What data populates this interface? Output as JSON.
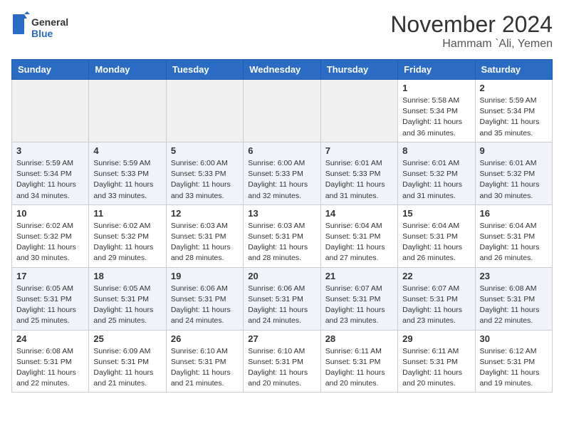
{
  "header": {
    "logo_general": "General",
    "logo_blue": "Blue",
    "month_year": "November 2024",
    "location": "Hammam `Ali, Yemen"
  },
  "weekdays": [
    "Sunday",
    "Monday",
    "Tuesday",
    "Wednesday",
    "Thursday",
    "Friday",
    "Saturday"
  ],
  "weeks": [
    [
      {
        "day": "",
        "info": ""
      },
      {
        "day": "",
        "info": ""
      },
      {
        "day": "",
        "info": ""
      },
      {
        "day": "",
        "info": ""
      },
      {
        "day": "",
        "info": ""
      },
      {
        "day": "1",
        "info": "Sunrise: 5:58 AM\nSunset: 5:34 PM\nDaylight: 11 hours\nand 36 minutes."
      },
      {
        "day": "2",
        "info": "Sunrise: 5:59 AM\nSunset: 5:34 PM\nDaylight: 11 hours\nand 35 minutes."
      }
    ],
    [
      {
        "day": "3",
        "info": "Sunrise: 5:59 AM\nSunset: 5:34 PM\nDaylight: 11 hours\nand 34 minutes."
      },
      {
        "day": "4",
        "info": "Sunrise: 5:59 AM\nSunset: 5:33 PM\nDaylight: 11 hours\nand 33 minutes."
      },
      {
        "day": "5",
        "info": "Sunrise: 6:00 AM\nSunset: 5:33 PM\nDaylight: 11 hours\nand 33 minutes."
      },
      {
        "day": "6",
        "info": "Sunrise: 6:00 AM\nSunset: 5:33 PM\nDaylight: 11 hours\nand 32 minutes."
      },
      {
        "day": "7",
        "info": "Sunrise: 6:01 AM\nSunset: 5:33 PM\nDaylight: 11 hours\nand 31 minutes."
      },
      {
        "day": "8",
        "info": "Sunrise: 6:01 AM\nSunset: 5:32 PM\nDaylight: 11 hours\nand 31 minutes."
      },
      {
        "day": "9",
        "info": "Sunrise: 6:01 AM\nSunset: 5:32 PM\nDaylight: 11 hours\nand 30 minutes."
      }
    ],
    [
      {
        "day": "10",
        "info": "Sunrise: 6:02 AM\nSunset: 5:32 PM\nDaylight: 11 hours\nand 30 minutes."
      },
      {
        "day": "11",
        "info": "Sunrise: 6:02 AM\nSunset: 5:32 PM\nDaylight: 11 hours\nand 29 minutes."
      },
      {
        "day": "12",
        "info": "Sunrise: 6:03 AM\nSunset: 5:31 PM\nDaylight: 11 hours\nand 28 minutes."
      },
      {
        "day": "13",
        "info": "Sunrise: 6:03 AM\nSunset: 5:31 PM\nDaylight: 11 hours\nand 28 minutes."
      },
      {
        "day": "14",
        "info": "Sunrise: 6:04 AM\nSunset: 5:31 PM\nDaylight: 11 hours\nand 27 minutes."
      },
      {
        "day": "15",
        "info": "Sunrise: 6:04 AM\nSunset: 5:31 PM\nDaylight: 11 hours\nand 26 minutes."
      },
      {
        "day": "16",
        "info": "Sunrise: 6:04 AM\nSunset: 5:31 PM\nDaylight: 11 hours\nand 26 minutes."
      }
    ],
    [
      {
        "day": "17",
        "info": "Sunrise: 6:05 AM\nSunset: 5:31 PM\nDaylight: 11 hours\nand 25 minutes."
      },
      {
        "day": "18",
        "info": "Sunrise: 6:05 AM\nSunset: 5:31 PM\nDaylight: 11 hours\nand 25 minutes."
      },
      {
        "day": "19",
        "info": "Sunrise: 6:06 AM\nSunset: 5:31 PM\nDaylight: 11 hours\nand 24 minutes."
      },
      {
        "day": "20",
        "info": "Sunrise: 6:06 AM\nSunset: 5:31 PM\nDaylight: 11 hours\nand 24 minutes."
      },
      {
        "day": "21",
        "info": "Sunrise: 6:07 AM\nSunset: 5:31 PM\nDaylight: 11 hours\nand 23 minutes."
      },
      {
        "day": "22",
        "info": "Sunrise: 6:07 AM\nSunset: 5:31 PM\nDaylight: 11 hours\nand 23 minutes."
      },
      {
        "day": "23",
        "info": "Sunrise: 6:08 AM\nSunset: 5:31 PM\nDaylight: 11 hours\nand 22 minutes."
      }
    ],
    [
      {
        "day": "24",
        "info": "Sunrise: 6:08 AM\nSunset: 5:31 PM\nDaylight: 11 hours\nand 22 minutes."
      },
      {
        "day": "25",
        "info": "Sunrise: 6:09 AM\nSunset: 5:31 PM\nDaylight: 11 hours\nand 21 minutes."
      },
      {
        "day": "26",
        "info": "Sunrise: 6:10 AM\nSunset: 5:31 PM\nDaylight: 11 hours\nand 21 minutes."
      },
      {
        "day": "27",
        "info": "Sunrise: 6:10 AM\nSunset: 5:31 PM\nDaylight: 11 hours\nand 20 minutes."
      },
      {
        "day": "28",
        "info": "Sunrise: 6:11 AM\nSunset: 5:31 PM\nDaylight: 11 hours\nand 20 minutes."
      },
      {
        "day": "29",
        "info": "Sunrise: 6:11 AM\nSunset: 5:31 PM\nDaylight: 11 hours\nand 20 minutes."
      },
      {
        "day": "30",
        "info": "Sunrise: 6:12 AM\nSunset: 5:31 PM\nDaylight: 11 hours\nand 19 minutes."
      }
    ]
  ]
}
